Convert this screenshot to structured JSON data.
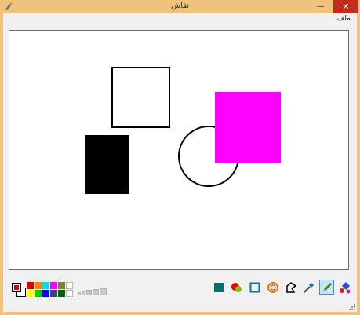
{
  "window": {
    "title": "نقاش",
    "minimize_glyph": "—",
    "maximize_glyph": "□",
    "close_glyph": "✕"
  },
  "menu": {
    "file_label": "ملف"
  },
  "canvas": {
    "background": "#ffffff",
    "shapes": [
      {
        "kind": "rectangle",
        "name": "outlined-square",
        "fill": "none",
        "stroke": "#000000"
      },
      {
        "kind": "rectangle",
        "name": "black-rectangle",
        "fill": "#000000",
        "stroke": "#000000"
      },
      {
        "kind": "ellipse",
        "name": "outlined-circle",
        "fill": "none",
        "stroke": "#000000"
      },
      {
        "kind": "rectangle",
        "name": "magenta-square",
        "fill": "#ff00ff",
        "stroke": "#ff00ff"
      }
    ]
  },
  "colors": {
    "foreground": "#e00000",
    "background": "#ffffff",
    "palette": [
      "#e00000",
      "#ff8000",
      "#00e0e0",
      "#ff00ff",
      "#808040",
      "#ffffff",
      "#ffff00",
      "#00d000",
      "#0000ff",
      "#404080",
      "#006000",
      "#ffffff"
    ]
  },
  "brush_sizes": [
    "1",
    "2",
    "3",
    "4",
    "5"
  ],
  "tools": [
    {
      "id": "fill-rect",
      "icon": "filled-square-icon",
      "color": "#007070"
    },
    {
      "id": "fill-ellipse",
      "icon": "filled-circles-icon",
      "color": "#e00000"
    },
    {
      "id": "rect",
      "icon": "square-outline-icon",
      "color": "#007c8c"
    },
    {
      "id": "ellipse",
      "icon": "circle-outline-icon",
      "color": "#e08000"
    },
    {
      "id": "polygon",
      "icon": "polygon-icon",
      "color": "#000000"
    },
    {
      "id": "picker",
      "icon": "eyedropper-icon",
      "color": "#1a6fbd"
    },
    {
      "id": "pencil",
      "icon": "pencil-icon",
      "color": "#2e8b2e",
      "selected": true
    },
    {
      "id": "fill",
      "icon": "paint-bucket-icon",
      "color": "#3050c0"
    }
  ]
}
